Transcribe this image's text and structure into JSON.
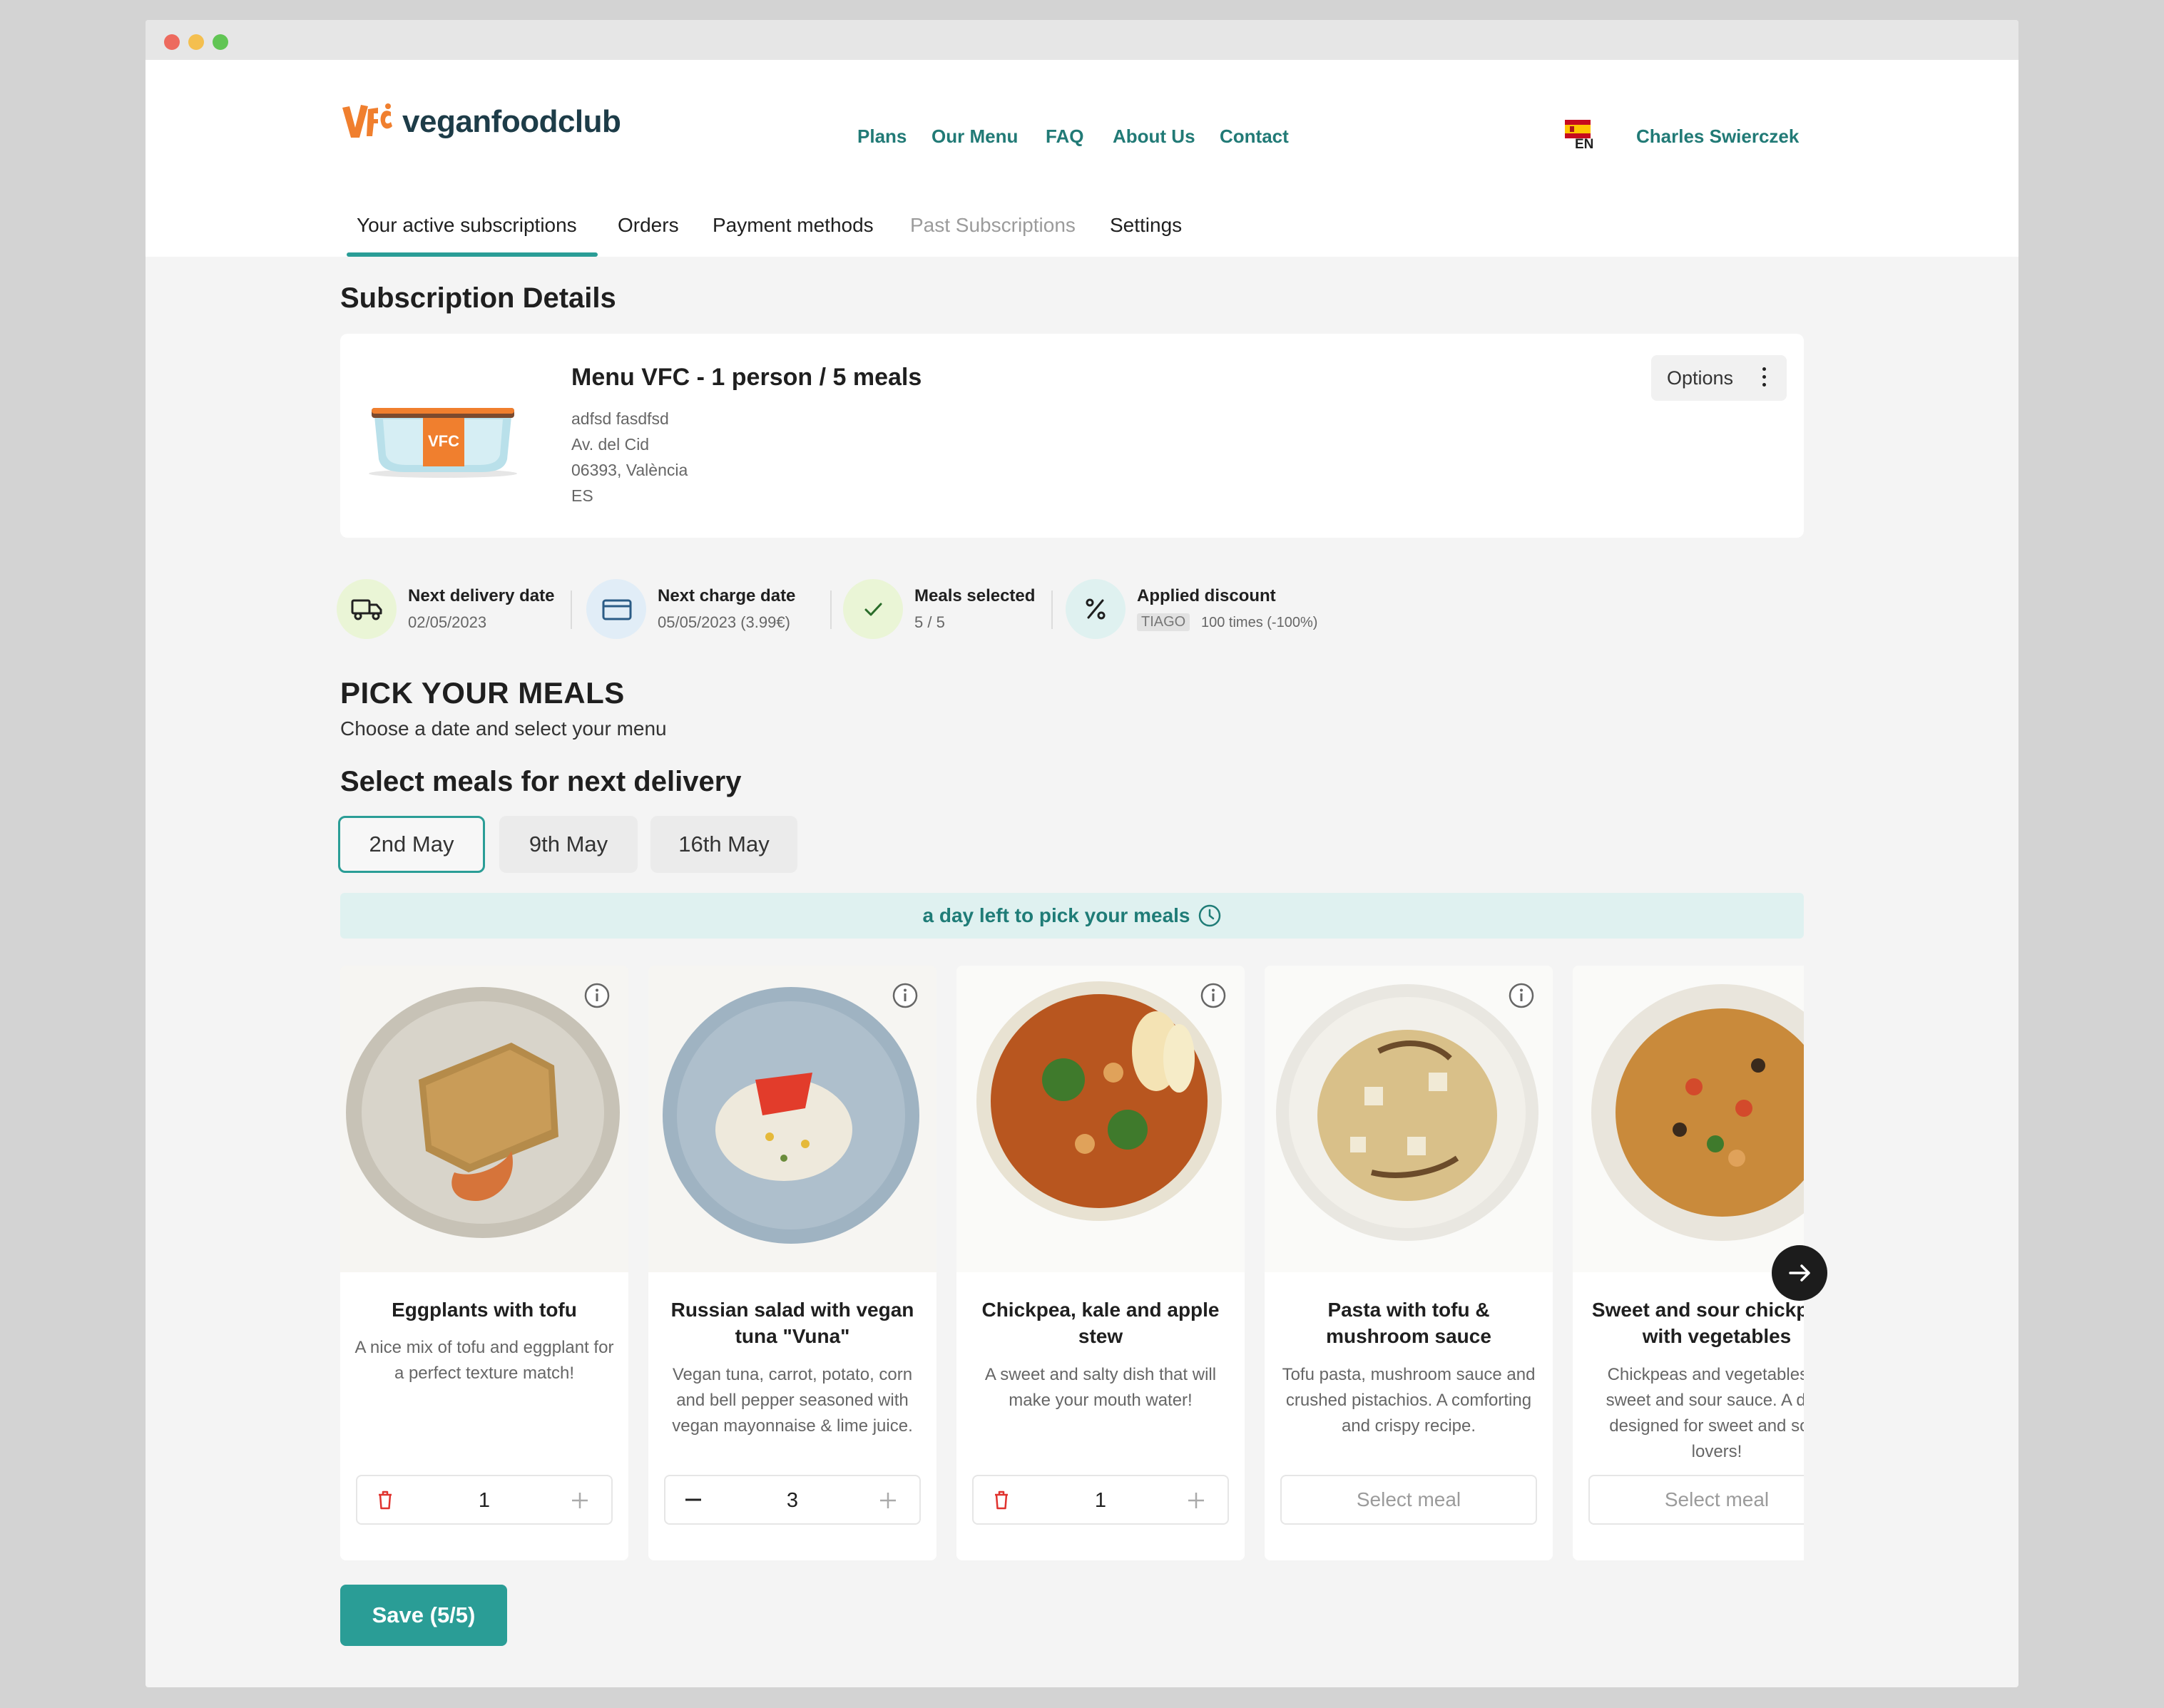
{
  "window": {
    "traffic_lights": [
      "#ed6a5e",
      "#f4bf4f",
      "#61c554"
    ]
  },
  "brand": {
    "logo_mark": "VFC",
    "logo_text": "veganfoodclub",
    "accent": "#2a9d96",
    "logo_color": "#f07f2e"
  },
  "nav": {
    "links": [
      "Plans",
      "Our Menu",
      "FAQ",
      "About Us",
      "Contact"
    ],
    "language": "EN",
    "user_name": "Charles Swierczek"
  },
  "account_tabs": {
    "items": [
      "Your active subscriptions",
      "Orders",
      "Payment methods",
      "Past Subscriptions",
      "Settings"
    ],
    "active": "Your active subscriptions",
    "disabled": "Past Subscriptions"
  },
  "subscription": {
    "heading": "Subscription Details",
    "product_badge": "VFC",
    "title": "Menu VFC - 1 person / 5 meals",
    "address_lines": [
      "adfsd fasdfsd",
      "Av. del Cid",
      "06393, València",
      "ES"
    ],
    "options_label": "Options"
  },
  "stats": [
    {
      "icon": "truck-icon",
      "label": "Next delivery date",
      "value": "02/05/2023",
      "bg": "#eaf5d6"
    },
    {
      "icon": "credit-card-icon",
      "label": "Next charge date",
      "value": "05/05/2023 (3.99€)",
      "bg": "#e1edf7"
    },
    {
      "icon": "check-icon",
      "label": "Meals selected",
      "value": "5 / 5",
      "bg": "#eaf5d6"
    },
    {
      "icon": "percent-icon",
      "label": "Applied discount",
      "code": "TIAGO",
      "value": "100 times (-100%)",
      "bg": "#dff1f0"
    }
  ],
  "picker": {
    "title": "PICK YOUR MEALS",
    "subtitle": "Choose a date and select your menu",
    "section_title": "Select meals for next delivery",
    "dates": [
      "2nd May",
      "9th May",
      "16th May"
    ],
    "active_date": "2nd May",
    "deadline_text": "a day left to pick your meals"
  },
  "meals": [
    {
      "title": "Eggplants with tofu",
      "description": "A nice mix of tofu and eggplant for a perfect texture match!",
      "quantity": "1",
      "state": "selected"
    },
    {
      "title": "Russian salad with vegan tuna \"Vuna\"",
      "description": "Vegan tuna, carrot, potato, corn and bell pepper seasoned with vegan mayonnaise & lime juice.",
      "quantity": "3",
      "state": "selected"
    },
    {
      "title": "Chickpea, kale and apple stew",
      "description": "A sweet and salty dish that will make your mouth water!",
      "quantity": "1",
      "state": "selected"
    },
    {
      "title": "Pasta with tofu & mushroom sauce",
      "description": "Tofu pasta, mushroom sauce and crushed pistachios. A comforting and crispy recipe.",
      "select_label": "Select meal",
      "state": "unselected"
    },
    {
      "title": "Sweet and sour chickpeas with vegetables",
      "description": "Chickpeas and vegetables in sweet and sour sauce. A dish designed for sweet and sour lovers!",
      "select_label": "Select meal",
      "state": "unselected"
    }
  ],
  "save_label": "Save (5/5)"
}
